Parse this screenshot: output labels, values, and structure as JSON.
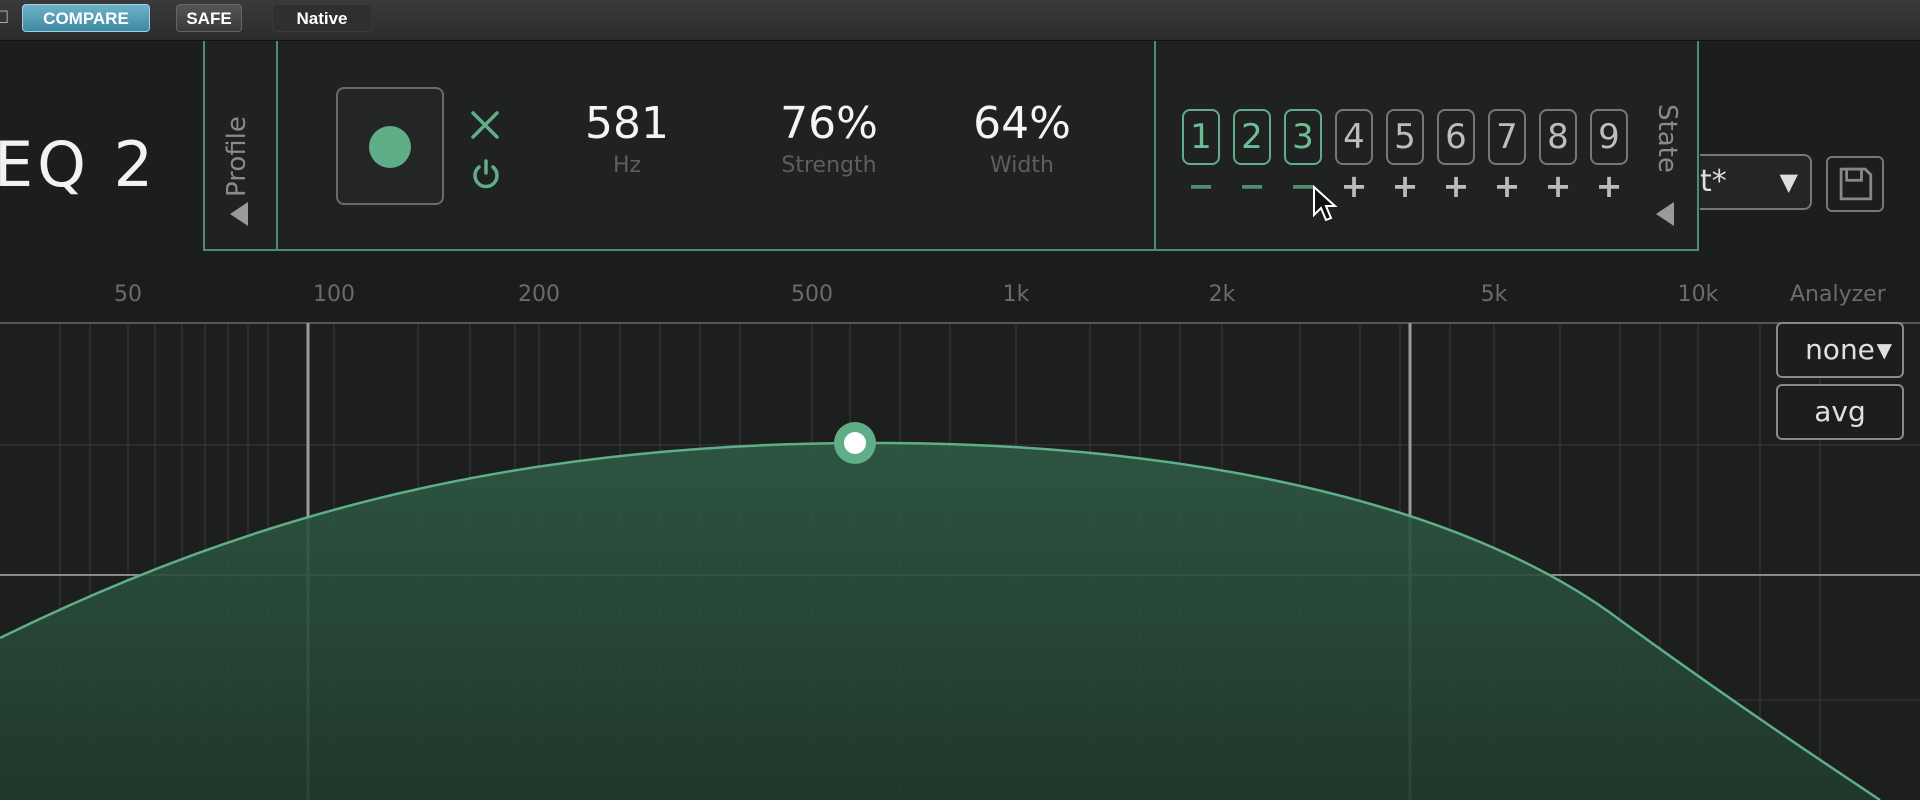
{
  "host": {
    "compare_label": "COMPARE",
    "safe_label": "SAFE",
    "native_label": "Native"
  },
  "plugin": {
    "title": "EQ 2"
  },
  "profile": {
    "label": "Profile"
  },
  "band": {
    "frequency": {
      "value": "581",
      "label": "Hz"
    },
    "strength": {
      "value": "76%",
      "label": "Strength"
    },
    "width": {
      "value": "64%",
      "label": "Width"
    }
  },
  "state": {
    "label": "State",
    "slots": [
      {
        "num": "1",
        "active": true,
        "mark": "−"
      },
      {
        "num": "2",
        "active": true,
        "mark": "−"
      },
      {
        "num": "3",
        "active": true,
        "mark": "−"
      },
      {
        "num": "4",
        "active": false,
        "mark": "+"
      },
      {
        "num": "5",
        "active": false,
        "mark": "+"
      },
      {
        "num": "6",
        "active": false,
        "mark": "+"
      },
      {
        "num": "7",
        "active": false,
        "mark": "+"
      },
      {
        "num": "8",
        "active": false,
        "mark": "+"
      },
      {
        "num": "9",
        "active": false,
        "mark": "+"
      }
    ]
  },
  "preset": {
    "value_visible": "t*"
  },
  "frequency_axis": {
    "labels": [
      "50",
      "100",
      "200",
      "500",
      "1k",
      "2k",
      "5k",
      "10k"
    ]
  },
  "analyzer": {
    "label": "Analyzer",
    "mode": "none",
    "avg_label": "avg"
  },
  "colors": {
    "accent": "#5fae88",
    "panel_border": "#4f8d6f",
    "background": "#1b1c1c",
    "compare_button": "#4f9bb5"
  },
  "icons": {
    "bypass": "x-icon",
    "power": "power-icon",
    "save": "save-icon",
    "dropdown": "chevron-down-icon",
    "profile_expand": "triangle-left-icon",
    "state_expand": "triangle-left-icon"
  }
}
